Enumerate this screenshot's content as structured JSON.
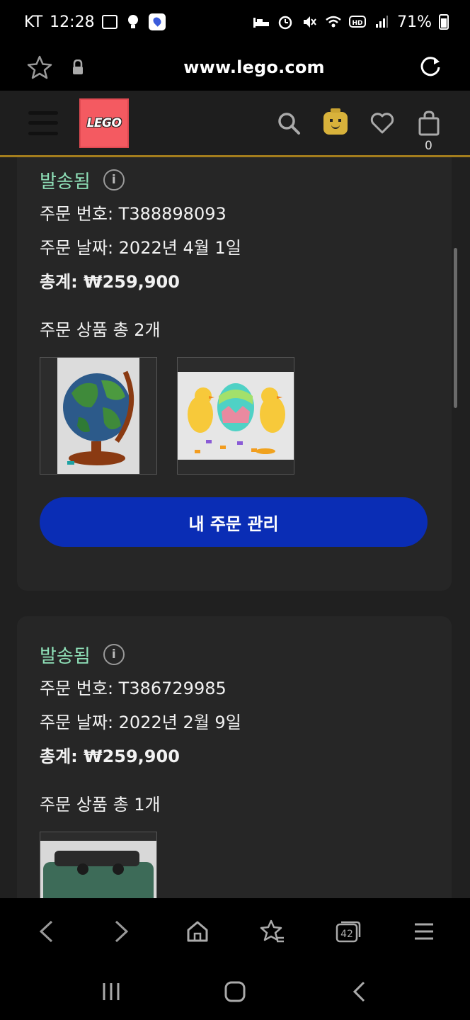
{
  "status_bar": {
    "carrier": "KT",
    "time": "12:28",
    "battery": "71%"
  },
  "browser": {
    "url": "www.lego.com"
  },
  "header": {
    "logo_text": "LEGO",
    "bag_count": "0"
  },
  "orders": [
    {
      "status": "발송됨",
      "order_number": "주문 번호: T388898093",
      "order_date": "주문 날짜: 2022년 4월 1일",
      "total": "총계: ₩259,900",
      "items_count": "주문 상품 총 2개",
      "button": "내 주문 관리"
    },
    {
      "status": "발송됨",
      "order_number": "주문 번호: T386729985",
      "order_date": "주문 날짜: 2022년 2월 9일",
      "total": "총계: ₩259,900",
      "items_count": "주문 상품 총 1개"
    }
  ],
  "browser_nav": {
    "tabs_count": "42"
  },
  "colors": {
    "status_green": "#8fe0b8",
    "button_blue": "#0a2db5",
    "header_border": "#a37d1d",
    "lego_red": "#f45a61"
  }
}
